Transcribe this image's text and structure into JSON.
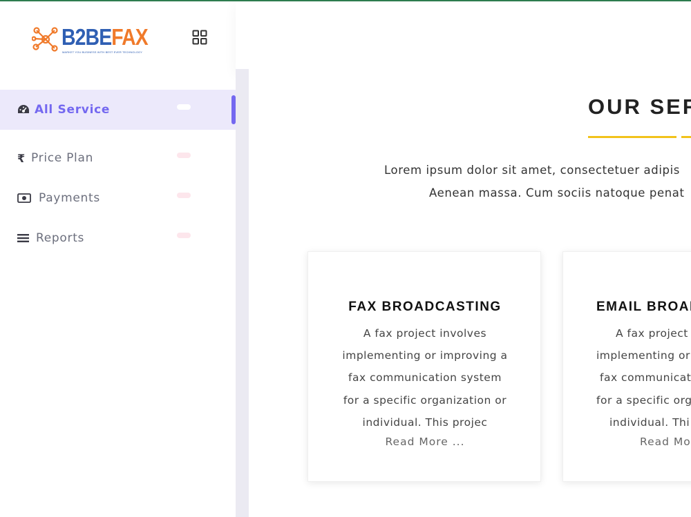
{
  "brand": {
    "name_part1": "B2BE",
    "name_part2": "FAX",
    "tagline": "MARKET YOU BUSINESS WITH BEST EVER TECHNOLOGY"
  },
  "sidebar": {
    "items": [
      {
        "label": "All Service",
        "icon": "dashboard-icon",
        "active": true
      },
      {
        "label": "Price Plan",
        "icon": "rupee-icon",
        "active": false
      },
      {
        "label": "Payments",
        "icon": "money-icon",
        "active": false
      },
      {
        "label": "Reports",
        "icon": "list-icon",
        "active": false
      }
    ]
  },
  "main": {
    "title": "OUR SER",
    "intro_line1": "Lorem ipsum dolor sit amet, consectetuer adipis",
    "intro_line2": "Aenean massa. Cum sociis natoque penat",
    "cards": [
      {
        "title": "FAX BROADCASTING",
        "lines": [
          "A fax project involves",
          "implementing or improving a",
          "fax communication system",
          "for a specific organization or",
          "individual. This projec"
        ],
        "more": "Read More ..."
      },
      {
        "title": "EMAIL BROAD",
        "lines": [
          "A fax project",
          "implementing or",
          "fax communicat",
          "for a specific org",
          "individual. Thi"
        ],
        "more": "Read Mo"
      }
    ]
  },
  "colors": {
    "accent": "#7468f0",
    "active_bg": "#ece9fb",
    "title_underline": "#f2c21b",
    "logo_blue": "#2f5fb3",
    "logo_orange": "#f07a2a",
    "top_line": "#2e7d4f"
  }
}
